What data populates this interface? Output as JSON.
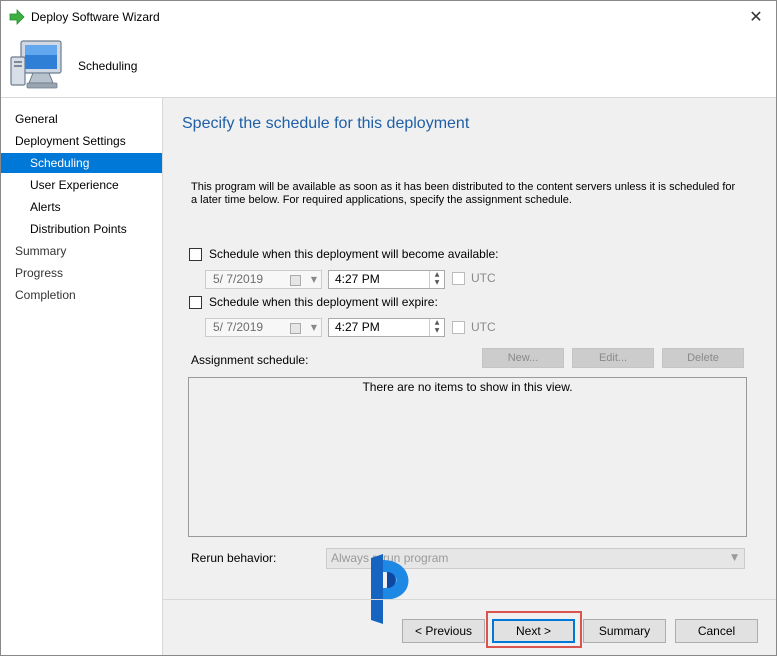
{
  "window": {
    "title": "Deploy Software Wizard"
  },
  "header": {
    "title": "Scheduling"
  },
  "nav": {
    "items": [
      {
        "label": "General",
        "level": 1,
        "active": false
      },
      {
        "label": "Deployment Settings",
        "level": 1,
        "active": false
      },
      {
        "label": "Scheduling",
        "level": 2,
        "active": true
      },
      {
        "label": "User Experience",
        "level": 2,
        "active": false
      },
      {
        "label": "Alerts",
        "level": 2,
        "active": false
      },
      {
        "label": "Distribution Points",
        "level": 2,
        "active": false
      },
      {
        "label": "Summary",
        "level": 1,
        "active": false
      },
      {
        "label": "Progress",
        "level": 1,
        "active": false
      },
      {
        "label": "Completion",
        "level": 1,
        "active": false
      }
    ]
  },
  "main": {
    "heading": "Specify the schedule for this deployment",
    "description": "This program will be available as soon as it has been distributed to the content servers unless it is scheduled for a later time below. For required applications, specify the assignment schedule.",
    "available": {
      "label": "Schedule when this deployment will become available:",
      "checked": false,
      "date": "5/ 7/2019",
      "time": "4:27 PM",
      "utc_label": "UTC"
    },
    "expire": {
      "label": "Schedule when this deployment will expire:",
      "checked": false,
      "date": "5/ 7/2019",
      "time": "4:27 PM",
      "utc_label": "UTC"
    },
    "assignment": {
      "label": "Assignment schedule:",
      "new_label": "New...",
      "edit_label": "Edit...",
      "delete_label": "Delete",
      "empty_message": "There are no items to show in this view."
    },
    "rerun": {
      "label": "Rerun behavior:",
      "value": "Always rerun program"
    }
  },
  "footer": {
    "previous_label": "< Previous",
    "next_label": "Next >",
    "summary_label": "Summary",
    "cancel_label": "Cancel"
  },
  "colors": {
    "accent": "#0078d7",
    "heading": "#1f5fa8",
    "highlight": "#d9534f"
  }
}
